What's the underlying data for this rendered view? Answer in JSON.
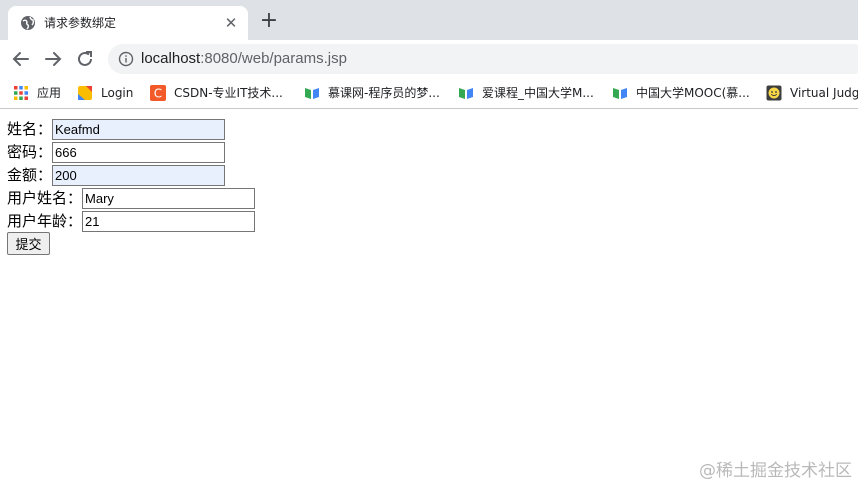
{
  "tab": {
    "title": "请求参数绑定",
    "close_glyph": "✕",
    "favicon": "globe-icon"
  },
  "newtab_glyph": "+",
  "toolbar": {
    "back": "arrow-left-icon",
    "forward": "arrow-right-icon",
    "reload": "reload-icon",
    "url_host": "localhost",
    "url_rest": ":8080/web/params.jsp"
  },
  "bookmarks": [
    {
      "label": "应用",
      "icon": "apps-grid-icon"
    },
    {
      "label": "Login",
      "icon": "bookmark-flag-icon"
    },
    {
      "label": "CSDN-专业IT技术...",
      "icon": "csdn-icon"
    },
    {
      "label": "慕课网-程序员的梦...",
      "icon": "book-icon"
    },
    {
      "label": "爱课程_中国大学M...",
      "icon": "book-icon"
    },
    {
      "label": "中国大学MOOC(慕...",
      "icon": "book-icon"
    },
    {
      "label": "Virtual Judge",
      "icon": "smiley-icon"
    }
  ],
  "form": {
    "name_label": "姓名：",
    "name_value": "Keafmd",
    "password_label": "密码：",
    "password_value": "666",
    "amount_label": "金额：",
    "amount_value": "200",
    "username_label": "用户姓名：",
    "username_value": "Mary",
    "userage_label": "用户年龄：",
    "userage_value": "21",
    "submit_label": "提交"
  },
  "watermark": "@稀土掘金技术社区",
  "colors": {
    "tabstrip": "#dee1e6",
    "omnibox": "#f1f3f4",
    "autofill": "#e8f0fe"
  }
}
